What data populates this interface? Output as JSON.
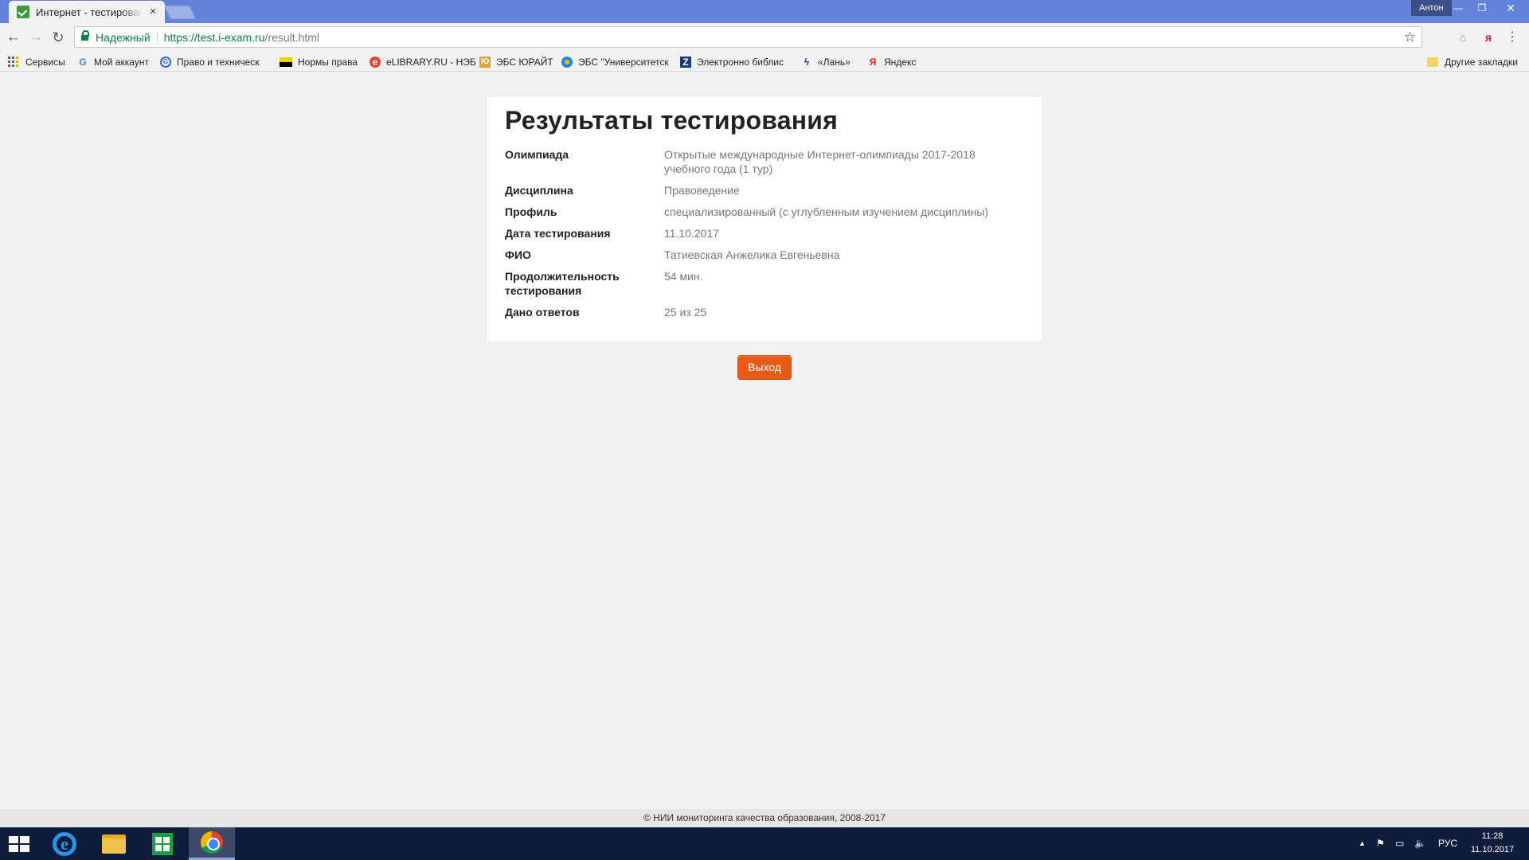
{
  "browser": {
    "tab_title": "Интернет - тестирование",
    "profile_name": "Антон",
    "security_label": "Надежный",
    "url_host": "https://test.i-exam.ru",
    "url_path": "/result.html"
  },
  "bookmarks": [
    {
      "label": "Сервисы",
      "icon": "apps-icon"
    },
    {
      "label": "Мой аккаунт",
      "icon": "google-icon"
    },
    {
      "label": "Право и техническ",
      "icon": "site-icon"
    },
    {
      "label": "Нормы права",
      "icon": "flag-icon"
    },
    {
      "label": "eLIBRARY.RU - НЭБ",
      "icon": "elibrary-icon"
    },
    {
      "label": "ЭБС ЮРАЙТ",
      "icon": "urait-icon"
    },
    {
      "label": "ЭБС \"Университетск",
      "icon": "university-icon"
    },
    {
      "label": "Электронно библис",
      "icon": "znanium-icon"
    },
    {
      "label": "«Лань»",
      "icon": "lan-icon"
    },
    {
      "label": "Яндекс",
      "icon": "yandex-icon"
    },
    {
      "label": "Другие закладки",
      "icon": "folder-icon"
    }
  ],
  "page": {
    "title": "Результаты тестирования",
    "rows": [
      {
        "label": "Олимпиада",
        "value": "Открытые международные Интернет-олимпиады 2017-2018 учебного года (1 тур)"
      },
      {
        "label": "Дисциплина",
        "value": "Правоведение"
      },
      {
        "label": "Профиль",
        "value": "специализированный (с углубленным изучением дисциплины)"
      },
      {
        "label": "Дата тестирования",
        "value": "11.10.2017"
      },
      {
        "label": "ФИО",
        "value": "Татиевская Анжелика Евгеньевна"
      },
      {
        "label": "Продолжительность тестирования",
        "value": "54 мин."
      },
      {
        "label": "Дано ответов",
        "value": "25 из 25"
      }
    ],
    "exit_label": "Выход",
    "footer": "© НИИ мониторинга качества образования, 2008-2017"
  },
  "taskbar": {
    "language": "РУС",
    "time": "11:28",
    "date": "11.10.2017"
  },
  "colors": {
    "accent": "#ea5a17",
    "titlebar": "#6283d9",
    "secure": "#0b8043"
  }
}
